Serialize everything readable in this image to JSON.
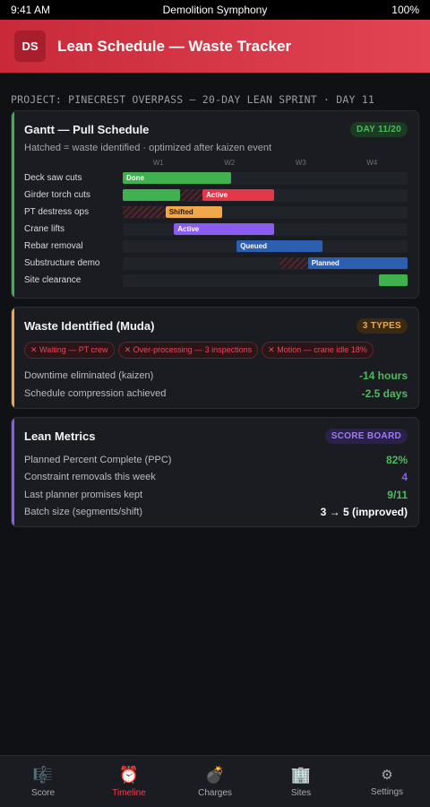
{
  "status_bar": {
    "time": "9:41 AM",
    "title": "Demolition Symphony",
    "battery": "100%"
  },
  "header": {
    "logo": "DS",
    "title": "Lean Schedule — Waste Tracker"
  },
  "project_line": "PROJECT: PINECREST OVERPASS — 20-DAY LEAN SPRINT · DAY 11",
  "gantt": {
    "title": "Gantt — Pull Schedule",
    "badge": "DAY 11/20",
    "subtitle": "Hatched = waste identified · optimized after kaizen event",
    "weeks": [
      "W1",
      "W2",
      "W3",
      "W4"
    ],
    "rows": [
      {
        "label": "Deck saw cuts",
        "bars": [
          {
            "start": 0,
            "end": 0.38,
            "text": "Done",
            "color": "#3fb24f"
          }
        ],
        "hatch": []
      },
      {
        "label": "Girder torch cuts",
        "bars": [
          {
            "start": 0,
            "end": 0.2,
            "text": "",
            "color": "#3fb24f"
          },
          {
            "start": 0.28,
            "end": 0.53,
            "text": "Active",
            "color": "#e2384a"
          }
        ],
        "hatch": [
          {
            "start": 0.2,
            "end": 0.28
          }
        ]
      },
      {
        "label": "PT destress ops",
        "bars": [
          {
            "start": 0.15,
            "end": 0.35,
            "text": "Shifted",
            "color": "#f0a84a"
          }
        ],
        "hatch": [
          {
            "start": 0,
            "end": 0.15
          }
        ]
      },
      {
        "label": "Crane lifts",
        "bars": [
          {
            "start": 0.18,
            "end": 0.53,
            "text": "Active",
            "color": "#8b5cf0"
          }
        ],
        "hatch": []
      },
      {
        "label": "Rebar removal",
        "bars": [
          {
            "start": 0.4,
            "end": 0.7,
            "text": "Queued",
            "color": "#2d5fb0"
          }
        ],
        "hatch": []
      },
      {
        "label": "Substructure demo",
        "bars": [
          {
            "start": 0.65,
            "end": 1.0,
            "text": "Planned",
            "color": "#2d5fb0"
          }
        ],
        "hatch": [
          {
            "start": 0.55,
            "end": 0.65
          }
        ]
      },
      {
        "label": "Site clearance",
        "bars": [
          {
            "start": 0.9,
            "end": 1.0,
            "text": "",
            "color": "#3fb24f"
          }
        ],
        "hatch": []
      }
    ]
  },
  "waste": {
    "title": "Waste Identified (Muda)",
    "badge": "3 TYPES",
    "chips": [
      "✕ Waiting — PT crew",
      "✕ Over-processing — 3 inspections",
      "✕ Motion — crane idle 18%"
    ],
    "rows": [
      {
        "label": "Downtime eliminated (kaizen)",
        "value": "-14 hours",
        "color": "#4cbb5a"
      },
      {
        "label": "Schedule compression achieved",
        "value": "-2.5 days",
        "color": "#4cbb5a"
      }
    ]
  },
  "metrics": {
    "title": "Lean Metrics",
    "badge": "SCORE BOARD",
    "rows": [
      {
        "label": "Planned Percent Complete (PPC)",
        "value": "82%",
        "color": "#4cbb5a"
      },
      {
        "label": "Constraint removals this week",
        "value": "4",
        "color": "#8b5cf0"
      },
      {
        "label": "Last planner promises kept",
        "value": "9/11",
        "color": "#4cbb5a"
      },
      {
        "label": "Batch size (segments/shift)",
        "value": "3 → 5 (improved)",
        "color": "#ffffff"
      }
    ]
  },
  "nav": [
    {
      "label": "Score",
      "icon": "🎼",
      "icon_name": "score-icon"
    },
    {
      "label": "Timeline",
      "icon": "⏰",
      "icon_name": "alarm-clock-icon",
      "active": true
    },
    {
      "label": "Charges",
      "icon": "💣",
      "icon_name": "bomb-icon"
    },
    {
      "label": "Sites",
      "icon": "🏢",
      "icon_name": "building-icon"
    },
    {
      "label": "Settings",
      "icon": "⚙",
      "icon_name": "gear-icon"
    }
  ]
}
